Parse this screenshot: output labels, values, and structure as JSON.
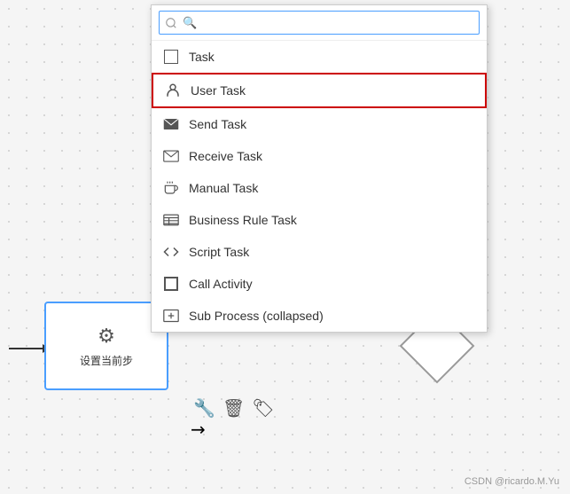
{
  "canvas": {
    "background": "#f5f5f5"
  },
  "dropdown": {
    "search_placeholder": "🔍",
    "items": [
      {
        "id": "task",
        "label": "Task",
        "icon": "task-box",
        "highlighted": false
      },
      {
        "id": "user-task",
        "label": "User Task",
        "icon": "user-task",
        "highlighted": true
      },
      {
        "id": "send-task",
        "label": "Send Task",
        "icon": "send",
        "highlighted": false
      },
      {
        "id": "receive-task",
        "label": "Receive Task",
        "icon": "receive",
        "highlighted": false
      },
      {
        "id": "manual-task",
        "label": "Manual Task",
        "icon": "manual",
        "highlighted": false
      },
      {
        "id": "business-rule-task",
        "label": "Business Rule Task",
        "icon": "business-rule",
        "highlighted": false
      },
      {
        "id": "script-task",
        "label": "Script Task",
        "icon": "script",
        "highlighted": false
      },
      {
        "id": "call-activity",
        "label": "Call Activity",
        "icon": "call-activity",
        "highlighted": false
      },
      {
        "id": "sub-process",
        "label": "Sub Process (collapsed)",
        "icon": "sub-process",
        "highlighted": false
      }
    ]
  },
  "node": {
    "label": "设置当前步",
    "icon": "⚙"
  },
  "watermark": {
    "text": "CSDN @ricardo.M.Yu"
  }
}
